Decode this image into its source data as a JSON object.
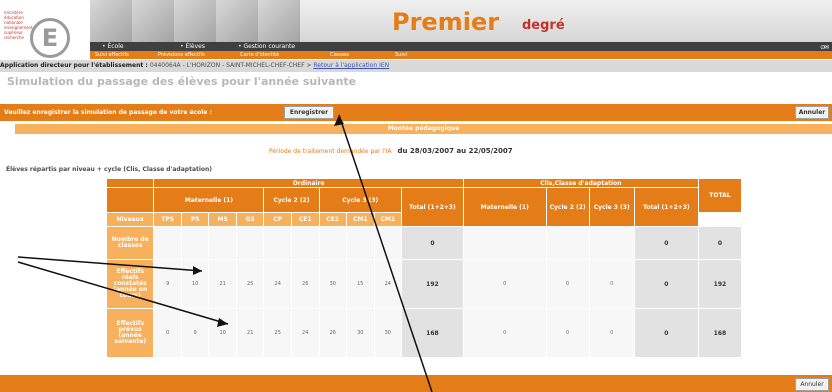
{
  "logo": {
    "small_text": "ministère éducation nationale enseignement supérieur recherche",
    "letter": "E"
  },
  "header": {
    "title": "Premier",
    "subtitle": "degré"
  },
  "nav": [
    "• École",
    "• Élèves",
    "• Gestion courante"
  ],
  "subnav": [
    "Suivi effectifs",
    "Prévisions effectifs",
    "Carte d'identité",
    "Classes",
    "Suivi"
  ],
  "breadcrumb": {
    "prefix": "Application directeur pour l'établissement : ",
    "school": "0440064A - L'HORIZON - SAINT-MICHEL-CHEF-CHEF",
    "sep": " > ",
    "link": "Retour à l'application IEN"
  },
  "page_title": "Simulation du passage des élèves pour l'année suivante",
  "notice": {
    "text": "Veuillez enregistrer la simulation de passage de votre école :",
    "save_label": "Enregistrer",
    "cancel_label": "Annuler"
  },
  "section_title": "Montée pédagogique",
  "period": {
    "label": "Période de traitement demandée par l'IA",
    "dates": "du 28/03/2007 au 22/05/2007"
  },
  "subheading": "Élèves répartis par niveau + cycle (Clis, Classe d'adaptation)",
  "table": {
    "ordinaire": "Ordinaire",
    "clis": "Clis,Classe d'adaptation",
    "maternelle": "Maternelle (1)",
    "cycle2": "Cycle 2 (2)",
    "cycle3": "Cycle 3 (3)",
    "total123": "Total (1+2+3)",
    "grand_total": "TOTAL",
    "niveaux": "Niveaux",
    "levels": [
      "TPS",
      "PS",
      "MS",
      "GS",
      "CP",
      "CE1",
      "CE2",
      "CM1",
      "CM2"
    ],
    "rows": [
      {
        "label": "Nombre de classes",
        "values": [
          "",
          "",
          "",
          "",
          "",
          "",
          "",
          "",
          ""
        ],
        "total": "0",
        "clis": [
          "",
          "",
          ""
        ],
        "clis_total": "0",
        "grand": "0"
      },
      {
        "label": "Effectifs réels constatés (année en cours)",
        "values": [
          "9",
          "10",
          "21",
          "25",
          "24",
          "26",
          "30",
          "15",
          "24"
        ],
        "total": "192",
        "clis": [
          "0",
          "0",
          "0"
        ],
        "clis_total": "0",
        "grand": "192"
      },
      {
        "label": "Effectifs prévus (année suivante)",
        "values": [
          "0",
          "9",
          "10",
          "21",
          "25",
          "24",
          "26",
          "30",
          "30"
        ],
        "total": "168",
        "clis": [
          "0",
          "0",
          "0"
        ],
        "clis_total": "0",
        "grand": "168"
      }
    ]
  },
  "icons": {
    "help": "help-icon",
    "mail": "mail-icon"
  }
}
